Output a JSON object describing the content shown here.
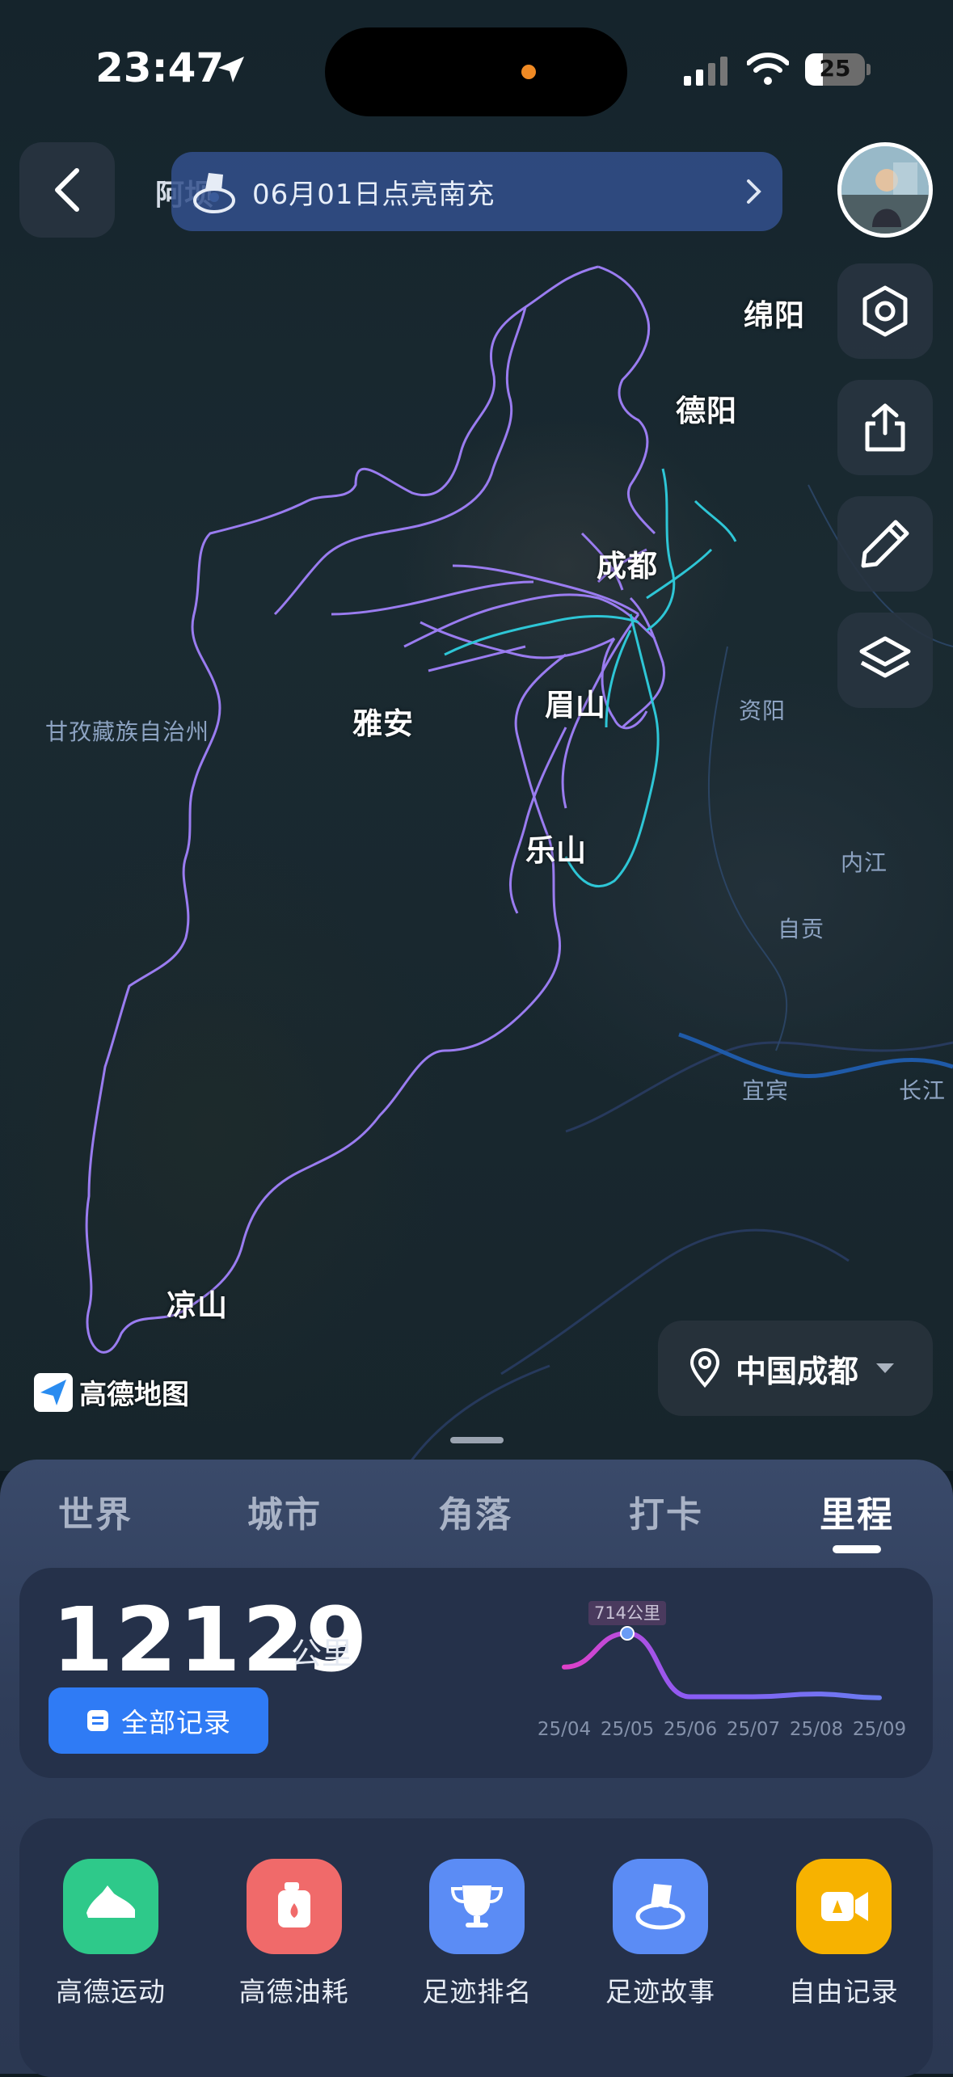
{
  "status_bar": {
    "time": "23:47",
    "battery": "25"
  },
  "banner": {
    "prefix": "阿坝",
    "text": "06月01日点亮南充"
  },
  "map": {
    "cities": [
      "绵阳",
      "德阳",
      "成都",
      "雅安",
      "眉山",
      "乐山",
      "凉山"
    ],
    "regions": [
      "甘孜藏族自治州",
      "资阳",
      "内江",
      "自贡",
      "宜宾",
      "长江"
    ],
    "logo": "高德地图",
    "location": "中国成都"
  },
  "tabs": [
    "世界",
    "城市",
    "角落",
    "打卡",
    "里程"
  ],
  "active_tab": "里程",
  "mileage": {
    "value": "12129",
    "unit": "公里",
    "all_records": "全部记录"
  },
  "chart_data": {
    "type": "line",
    "x": [
      "25/04",
      "25/05",
      "25/06",
      "25/07",
      "25/08",
      "25/09"
    ],
    "series": [
      {
        "values": [
          350,
          714,
          30,
          30,
          60,
          20
        ]
      }
    ],
    "annotation": "714公里",
    "highlight_index": 1,
    "gradient_colors": [
      "#e040c8",
      "#8a5cf5",
      "#6a7cf0"
    ]
  },
  "apps": [
    {
      "label": "高德运动",
      "color": "#2ec98a",
      "icon": "shoe-icon"
    },
    {
      "label": "高德油耗",
      "color": "#f06a6a",
      "icon": "fuel-can-icon"
    },
    {
      "label": "足迹排名",
      "color": "#5b8cf5",
      "icon": "trophy-icon"
    },
    {
      "label": "足迹故事",
      "color": "#5b8cf5",
      "icon": "story-icon"
    },
    {
      "label": "自由记录",
      "color": "#f7b200",
      "icon": "video-icon"
    }
  ]
}
